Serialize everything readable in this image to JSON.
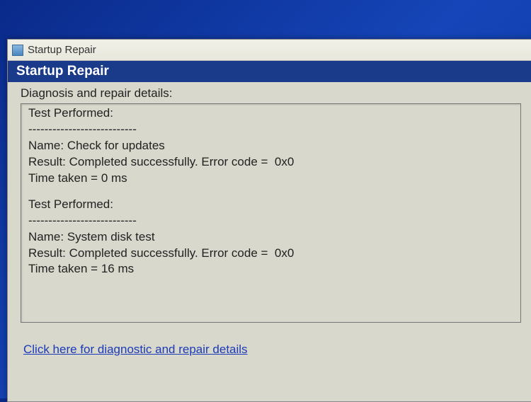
{
  "window": {
    "title": "Startup Repair"
  },
  "header": {
    "title": "Startup Repair"
  },
  "section": {
    "label": "Diagnosis and repair details:"
  },
  "tests": [
    {
      "header": "Test Performed:",
      "divider": "---------------------------",
      "name_label": "Name:",
      "name": "Check for updates",
      "result_label": "Result:",
      "result": "Completed successfully. Error code =  0x0",
      "time_label": "Time taken =",
      "time": "0 ms"
    },
    {
      "header": "Test Performed:",
      "divider": "---------------------------",
      "name_label": "Name:",
      "name": "System disk test",
      "result_label": "Result:",
      "result": "Completed successfully. Error code =  0x0",
      "time_label": "Time taken =",
      "time": "16 ms"
    }
  ],
  "link": {
    "text": "Click here for diagnostic and repair details"
  }
}
